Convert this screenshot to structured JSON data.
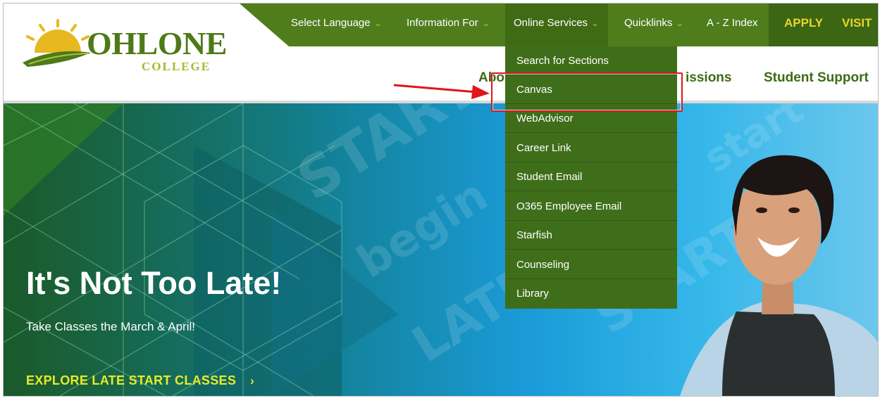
{
  "logo": {
    "name": "OHLONE",
    "sub": "COLLEGE"
  },
  "topnav": {
    "select_language": "Select Language",
    "information_for": "Information For",
    "online_services": "Online Services",
    "quicklinks": "Quicklinks",
    "az_index": "A - Z Index",
    "apply": "APPLY",
    "visit": "VISIT"
  },
  "secondary_nav": {
    "about": "Abo",
    "admissions": "issions",
    "student_support": "Student Support"
  },
  "dropdown": {
    "items": [
      "Search for Sections",
      "Canvas",
      "WebAdvisor",
      "Career Link",
      "Student Email",
      "O365 Employee Email",
      "Starfish",
      "Counseling",
      "Library"
    ]
  },
  "hero": {
    "title": "It's Not Too Late!",
    "subtitle": "Take Classes the March & April!",
    "cta": "EXPLORE LATE START CLASSES",
    "cta_arrow": "›"
  },
  "colors": {
    "nav_green": "#4f7d1c",
    "active_green": "#3e6b14",
    "accent_yellow": "#ead52b",
    "annotation_red": "#e0141c"
  }
}
